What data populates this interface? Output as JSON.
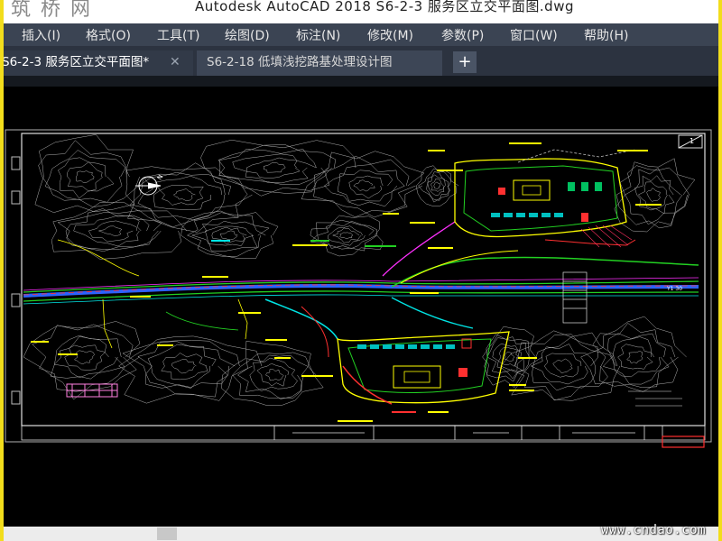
{
  "window": {
    "title": "Autodesk AutoCAD 2018      S6-2-3 服务区立交平面图.dwg",
    "watermark_top": "筑 桥 网"
  },
  "menu": [
    {
      "label": "插入(I)",
      "name": "menu-insert"
    },
    {
      "label": "格式(O)",
      "name": "menu-format"
    },
    {
      "label": "工具(T)",
      "name": "menu-tools"
    },
    {
      "label": "绘图(D)",
      "name": "menu-draw"
    },
    {
      "label": "标注(N)",
      "name": "menu-dimension"
    },
    {
      "label": "修改(M)",
      "name": "menu-modify"
    },
    {
      "label": "参数(P)",
      "name": "menu-parametric"
    },
    {
      "label": "窗口(W)",
      "name": "menu-window"
    },
    {
      "label": "帮助(H)",
      "name": "menu-help"
    }
  ],
  "tabs": [
    {
      "label": "S6-2-3 服务区立交平面图*",
      "active": true
    },
    {
      "label": "S6-2-18 低填浅挖路基处理设计图",
      "active": false
    }
  ],
  "tab_close_glyph": "✕",
  "tab_new_glyph": "+",
  "drawing": {
    "sheet_label": "1",
    "north_label": "N",
    "station_label": "Y1 30",
    "colors": {
      "background": "#000000",
      "contour": "#cfcfcf",
      "road_cyan": "#00e5e5",
      "road_green": "#22d022",
      "road_yellow": "#ffff00",
      "road_red": "#ff3030",
      "road_blue": "#2c62ff",
      "road_magenta": "#ff30ff"
    }
  },
  "footer_watermark": "www.cndao.com"
}
